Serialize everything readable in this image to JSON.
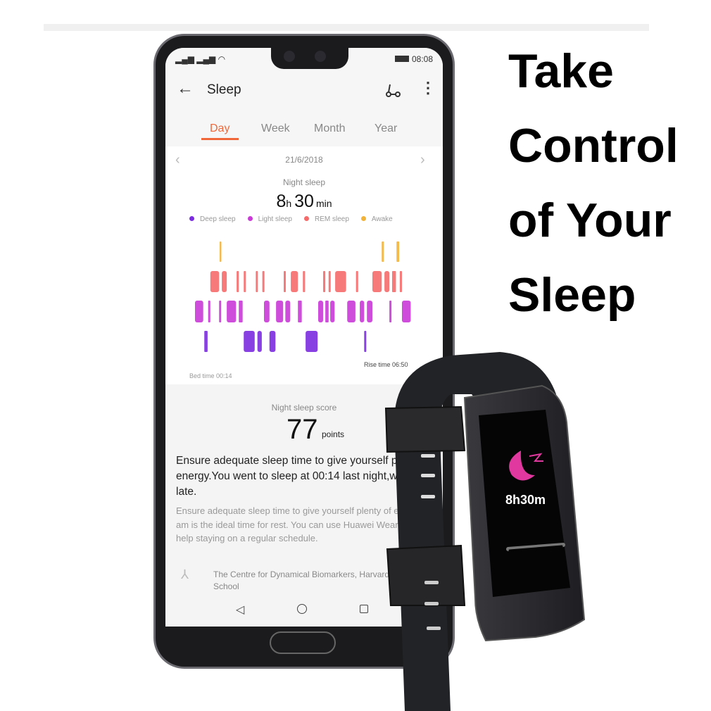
{
  "headline": [
    "Take",
    "Control",
    "of Your",
    "Sleep"
  ],
  "status_bar": {
    "time": "08:08",
    "signal": "4G signal",
    "icons": [
      "signal-icon",
      "wifi-icon",
      "battery-icon"
    ]
  },
  "app": {
    "title": "Sleep",
    "back_icon": "arrow-left-icon",
    "share_icon": "share-icon",
    "more_icon": "more-vertical-icon"
  },
  "tabs": [
    {
      "label": "Day",
      "active": true
    },
    {
      "label": "Week"
    },
    {
      "label": "Month"
    },
    {
      "label": "Year"
    }
  ],
  "accent": "#f0683a",
  "date": "21/6/2018",
  "night_sleep": {
    "label": "Night sleep",
    "hours": "8",
    "h": "h",
    "minutes": "30",
    "min": "min"
  },
  "legend": [
    {
      "label": "Deep sleep",
      "color": "#7b2be0"
    },
    {
      "label": "Light sleep",
      "color": "#c93ad6"
    },
    {
      "label": "REM sleep",
      "color": "#f56b6b"
    },
    {
      "label": "Awake",
      "color": "#f2b33a"
    }
  ],
  "bed_time": "Bed time 00:14",
  "rise_time": "Rise time 06:50",
  "chart_data": {
    "type": "hypnogram",
    "start": "00:14",
    "end": "06:50",
    "stages": [
      "Awake",
      "REM sleep",
      "Light sleep",
      "Deep sleep"
    ],
    "segments": [
      {
        "stage": "Light sleep",
        "from": "00:14",
        "to": "00:29"
      },
      {
        "stage": "Deep sleep",
        "from": "00:31",
        "to": "00:37"
      },
      {
        "stage": "Light sleep",
        "from": "00:38",
        "to": "00:42"
      },
      {
        "stage": "REM sleep",
        "from": "00:42",
        "to": "00:58"
      },
      {
        "stage": "Light sleep",
        "from": "00:58",
        "to": "01:00"
      },
      {
        "stage": "Awake",
        "from": "00:59",
        "to": "01:02"
      },
      {
        "stage": "REM sleep",
        "from": "01:03",
        "to": "01:12"
      },
      {
        "stage": "Light sleep",
        "from": "01:12",
        "to": "01:29"
      },
      {
        "stage": "REM sleep",
        "from": "01:30",
        "to": "01:34"
      },
      {
        "stage": "Light sleep",
        "from": "01:34",
        "to": "01:41"
      },
      {
        "stage": "REM sleep",
        "from": "01:43",
        "to": "01:44"
      },
      {
        "stage": "Deep sleep",
        "from": "01:43",
        "to": "02:03"
      },
      {
        "stage": "REM sleep",
        "from": "02:05",
        "to": "02:07"
      },
      {
        "stage": "Deep sleep",
        "from": "02:08",
        "to": "02:16"
      },
      {
        "stage": "REM sleep",
        "from": "02:17",
        "to": "02:20"
      },
      {
        "stage": "Light sleep",
        "from": "02:20",
        "to": "02:30"
      },
      {
        "stage": "Deep sleep",
        "from": "02:30",
        "to": "02:41"
      },
      {
        "stage": "Light sleep",
        "from": "02:42",
        "to": "02:55"
      },
      {
        "stage": "REM sleep",
        "from": "02:56",
        "to": "02:59"
      },
      {
        "stage": "Light sleep",
        "from": "02:59",
        "to": "03:08"
      },
      {
        "stage": "REM sleep",
        "from": "03:09",
        "to": "03:22"
      },
      {
        "stage": "Light sleep",
        "from": "03:22",
        "to": "03:29"
      },
      {
        "stage": "REM sleep",
        "from": "03:31",
        "to": "03:35"
      },
      {
        "stage": "Deep sleep",
        "from": "03:36",
        "to": "03:58"
      },
      {
        "stage": "Light sleep",
        "from": "03:59",
        "to": "04:08"
      },
      {
        "stage": "REM sleep",
        "from": "04:08",
        "to": "04:12"
      },
      {
        "stage": "Light sleep",
        "from": "04:12",
        "to": "04:18"
      },
      {
        "stage": "REM sleep",
        "from": "04:18",
        "to": "04:21"
      },
      {
        "stage": "Light sleep",
        "from": "04:21",
        "to": "04:29"
      },
      {
        "stage": "REM sleep",
        "from": "04:30",
        "to": "04:50"
      },
      {
        "stage": "Light sleep",
        "from": "04:52",
        "to": "05:07"
      },
      {
        "stage": "REM sleep",
        "from": "05:08",
        "to": "05:12"
      },
      {
        "stage": "Light sleep",
        "from": "05:15",
        "to": "05:23"
      },
      {
        "stage": "Deep sleep",
        "from": "05:23",
        "to": "05:26"
      },
      {
        "stage": "Light sleep",
        "from": "05:28",
        "to": "05:38"
      },
      {
        "stage": "REM sleep",
        "from": "05:38",
        "to": "05:55"
      },
      {
        "stage": "Awake",
        "from": "05:55",
        "to": "05:59"
      },
      {
        "stage": "REM sleep",
        "from": "06:00",
        "to": "06:09"
      },
      {
        "stage": "Light sleep",
        "from": "06:09",
        "to": "06:12"
      },
      {
        "stage": "REM sleep",
        "from": "06:14",
        "to": "06:21"
      },
      {
        "stage": "Awake",
        "from": "06:22",
        "to": "06:27"
      },
      {
        "stage": "REM sleep",
        "from": "06:28",
        "to": "06:32"
      },
      {
        "stage": "Light sleep",
        "from": "06:32",
        "to": "06:48"
      }
    ]
  },
  "score": {
    "label": "Night sleep score",
    "value": "77",
    "unit": "points"
  },
  "advice_bold": "Ensure adequate sleep time to give yourself plenty of energy.You went to sleep at 00:14 last night,which was a little late.",
  "advice_body": "Ensure adequate sleep time to give yourself plenty of energy.10 pm to 6 am is the ideal time for rest. You can use Huawei Wear to set alarms to help staying on a regular schedule.",
  "source": "The Centre for Dynamical Biomarkers, Harvard Medical School",
  "nav": {
    "back": "back-triangle-icon",
    "home": "home-circle-icon",
    "recent": "recent-square-icon"
  },
  "watch": {
    "display": "8h30m",
    "icon": "sleep-moon-icon"
  }
}
